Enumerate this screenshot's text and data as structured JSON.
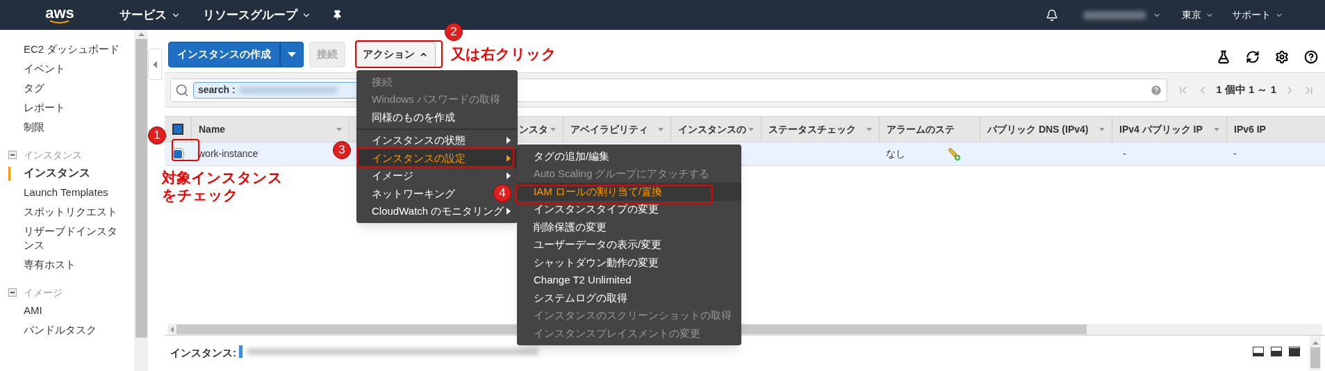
{
  "top_bar": {
    "logo": "aws",
    "nav": [
      {
        "label": "サービス"
      },
      {
        "label": "リソースグループ"
      }
    ],
    "region": "東京",
    "support": "サポート"
  },
  "sidebar": {
    "groups": [
      {
        "items": [
          {
            "label": "EC2 ダッシュボード",
            "selected": false
          },
          {
            "label": "イベント",
            "selected": false
          },
          {
            "label": "タグ",
            "selected": false
          },
          {
            "label": "レポート",
            "selected": false
          },
          {
            "label": "制限",
            "selected": false
          }
        ]
      },
      {
        "title": "インスタンス",
        "expanded": true,
        "items": [
          {
            "label": "インスタンス",
            "selected": true
          },
          {
            "label": "Launch Templates",
            "selected": false
          },
          {
            "label": "スポットリクエスト",
            "selected": false
          },
          {
            "label": "リザーブドインスタンス",
            "selected": false
          },
          {
            "label": "専有ホスト",
            "selected": false
          }
        ]
      },
      {
        "title": "イメージ",
        "expanded": true,
        "items": [
          {
            "label": "AMI",
            "selected": false
          },
          {
            "label": "バンドルタスク",
            "selected": false
          }
        ]
      }
    ]
  },
  "toolbar": {
    "create_button": "インスタンスの作成",
    "connect_button": {
      "label": "接続",
      "disabled": true
    },
    "actions_button": {
      "label": "アクション",
      "expanded": true
    }
  },
  "search": {
    "chip": "search :"
  },
  "pagination": "1 個中 1 ～ 1",
  "table": {
    "select_all_checked": true,
    "columns": [
      {
        "label": "Name",
        "sortable": true
      },
      {
        "label": "ンスタ",
        "sortable": true
      },
      {
        "label": "アベイラビリティ",
        "sortable": true
      },
      {
        "label": "インスタンスの",
        "sortable": true
      },
      {
        "label": "ステータスチェック",
        "sortable": true
      },
      {
        "label": "アラームのステ",
        "sortable": false
      },
      {
        "label": "パブリック DNS (IPv4)",
        "sortable": true
      },
      {
        "label": "IPv4 パブリック IP",
        "sortable": true
      },
      {
        "label": "IPv6 IP",
        "sortable": false
      }
    ],
    "rows": [
      {
        "selected": true,
        "checked": true,
        "name": "work-instance",
        "alarm_status": "なし",
        "public_ipv4": "-",
        "ipv6": "-"
      }
    ]
  },
  "bottom_panel": {
    "label": "インスタンス:"
  },
  "actions_menu": {
    "groups": [
      [
        {
          "label": "接続",
          "disabled": true,
          "submenu": false,
          "highlighted": false
        },
        {
          "label": "Windows パスワードの取得",
          "disabled": true,
          "submenu": false,
          "highlighted": false
        },
        {
          "label": "同様のものを作成",
          "disabled": false,
          "submenu": false,
          "highlighted": false
        }
      ],
      [
        {
          "label": "インスタンスの状態",
          "disabled": false,
          "submenu": true,
          "highlighted": false
        },
        {
          "label": "インスタンスの設定",
          "disabled": false,
          "submenu": true,
          "highlighted": true
        },
        {
          "label": "イメージ",
          "disabled": false,
          "submenu": true,
          "highlighted": false
        },
        {
          "label": "ネットワーキング",
          "disabled": false,
          "highlighted": false
        },
        {
          "label": "CloudWatch のモニタリング",
          "disabled": false,
          "submenu": true,
          "highlighted": false
        }
      ]
    ]
  },
  "settings_submenu": {
    "items": [
      {
        "label": "タグの追加/編集",
        "disabled": false,
        "highlighted": false
      },
      {
        "label": "Auto Scaling グループにアタッチする",
        "disabled": true,
        "highlighted": false
      },
      {
        "label": "IAM ロールの割り当て/置換",
        "disabled": false,
        "highlighted": true
      },
      {
        "label": "インスタンスタイプの変更",
        "disabled": false,
        "highlighted": false
      },
      {
        "label": "削除保護の変更",
        "disabled": false,
        "highlighted": false
      },
      {
        "label": "ユーザーデータの表示/変更",
        "disabled": false,
        "highlighted": false
      },
      {
        "label": "シャットダウン動作の変更",
        "disabled": false,
        "highlighted": false
      },
      {
        "label": "Change T2 Unlimited",
        "disabled": false,
        "highlighted": false
      },
      {
        "label": "システムログの取得",
        "disabled": false,
        "highlighted": false
      },
      {
        "label": "インスタンスのスクリーンショットの取得",
        "disabled": true,
        "highlighted": false
      },
      {
        "label": "インスタンスプレイスメントの変更",
        "disabled": true,
        "highlighted": false
      }
    ]
  },
  "annotations": {
    "badges": [
      "1",
      "2",
      "3",
      "4"
    ],
    "notes": [
      "又は右クリック",
      "対象インスタンス",
      "をチェック"
    ]
  }
}
